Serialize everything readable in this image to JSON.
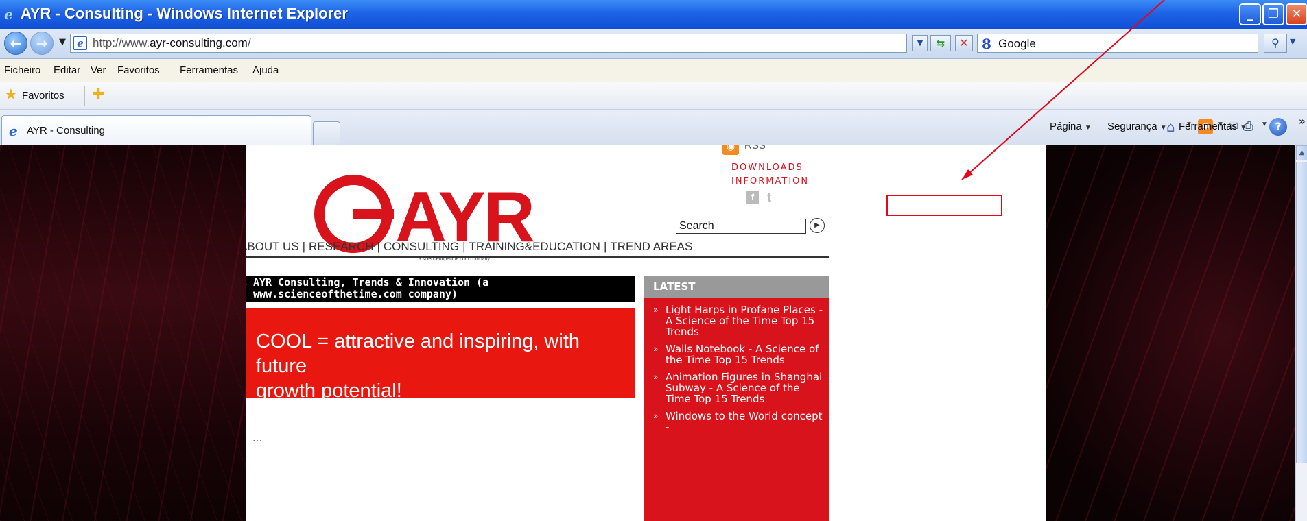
{
  "window": {
    "title": "AYR - Consulting - Windows Internet Explorer"
  },
  "address": {
    "url_prefix": "http://www.",
    "url_domain": "ayr-consulting.com",
    "url_suffix": "/"
  },
  "search": {
    "placeholder": "Google"
  },
  "menu": [
    "Ficheiro",
    "Editar",
    "Ver",
    "Favoritos",
    "Ferramentas",
    "Ajuda"
  ],
  "favorites": {
    "label": "Favoritos"
  },
  "tab": {
    "title": "AYR - Consulting"
  },
  "commands": {
    "page": "Página",
    "security": "Segurança",
    "tools": "Ferramentas"
  },
  "site": {
    "logo_text": "AYR",
    "logo_tagline": "a scienceofthetime.com company",
    "rss": "RSS",
    "downloads": "DOWNLOADS",
    "information": "INFORMATION",
    "search_placeholder": "Search",
    "nav": [
      "ABOUT US",
      "RESEARCH",
      "CONSULTING",
      "TRAINING&EDUCATION",
      "TREND AREAS"
    ],
    "feature_title": "AYR Consulting, Trends & Innovation (a www.scienceofthetime.com company)",
    "feature_quote_line1": "COOL = attractive and inspiring, with future",
    "feature_quote_line2": "growth potential!",
    "body_snippet": "...",
    "latest_title": "LATEST",
    "latest_items": [
      "Light Harps in Profane Places - A Science of the Time Top 15 Trends",
      "Walls Notebook - A Science of the Time Top 15 Trends",
      "Animation Figures in Shanghai Subway - A Science of the Time Top 15 Trends",
      "Windows to the World concept -"
    ]
  },
  "colors": {
    "brand_red": "#d8131c",
    "annotation_red": "#e4061a",
    "ie_blue": "#1f63e6"
  }
}
